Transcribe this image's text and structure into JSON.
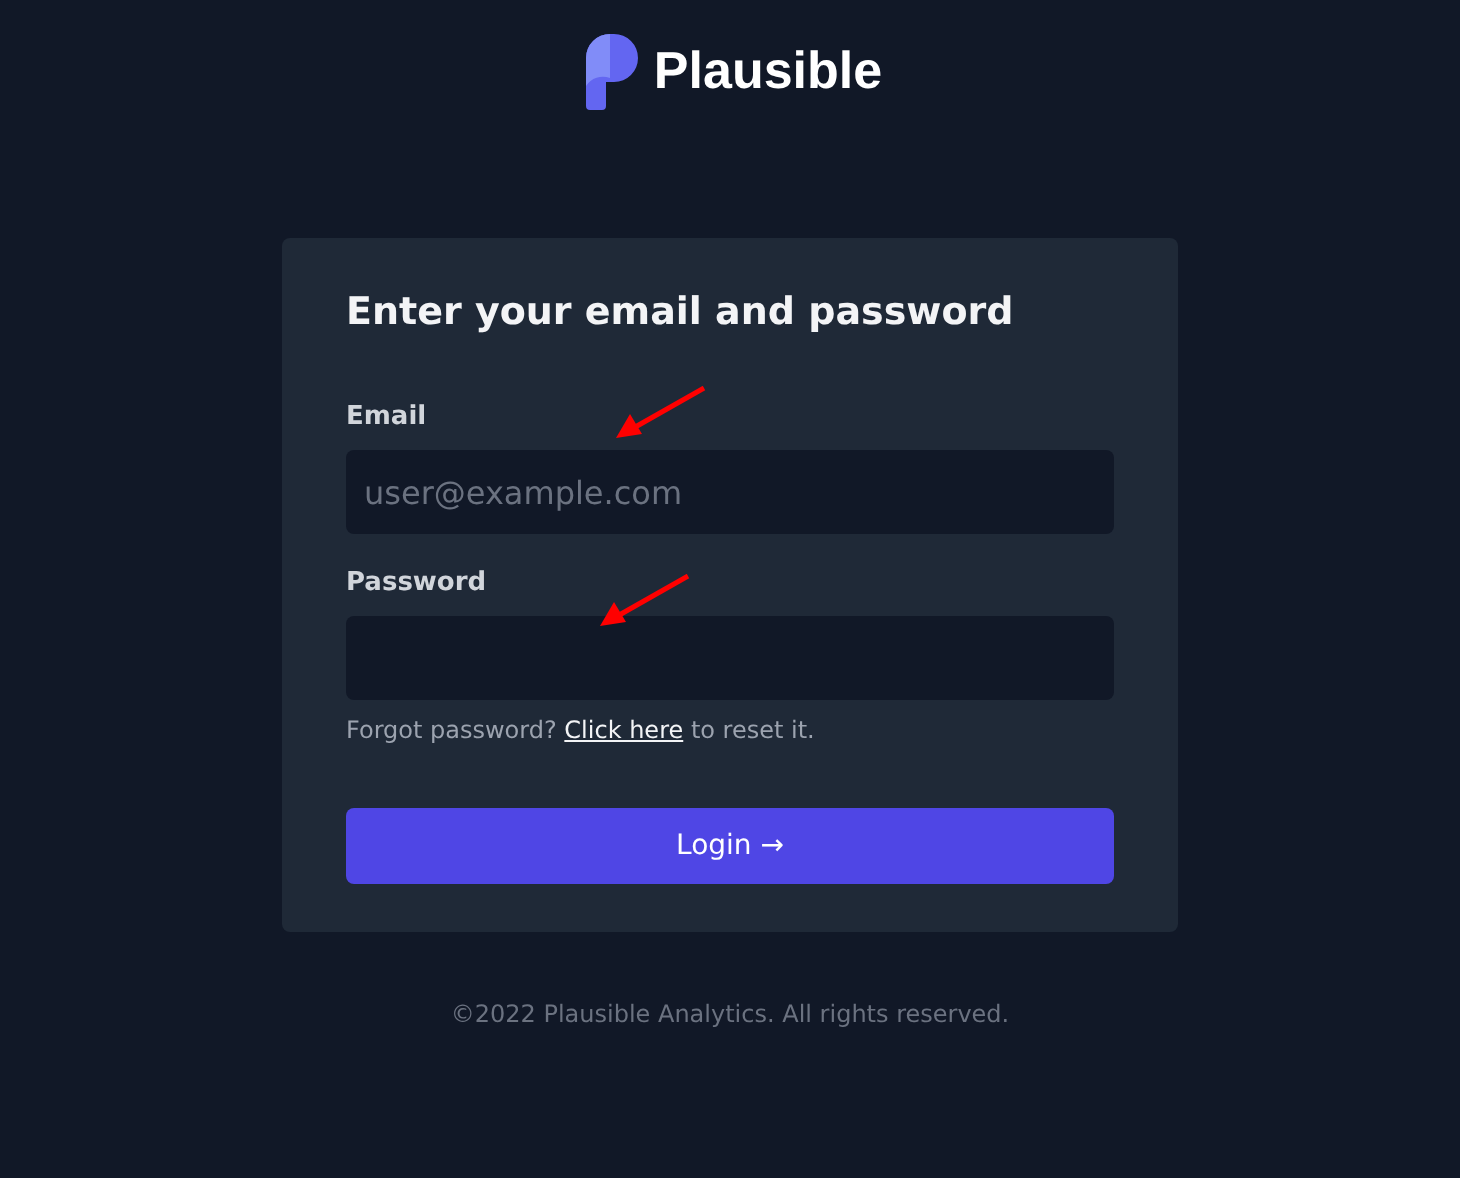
{
  "brand": {
    "name": "Plausible"
  },
  "login_form": {
    "title": "Enter your email and password",
    "fields": [
      {
        "label": "Email",
        "placeholder": "user@example.com"
      },
      {
        "label": "Password"
      }
    ],
    "forgot": {
      "before": "Forgot password? ",
      "link": "Click here",
      "after": " to reset it."
    },
    "submit": "Login →"
  },
  "annotations": [
    {
      "kind": "arrow",
      "color": "#ff0000"
    },
    {
      "kind": "arrow",
      "color": "#ff0000"
    }
  ],
  "footer": "©2022 Plausible Analytics. All rights reserved."
}
